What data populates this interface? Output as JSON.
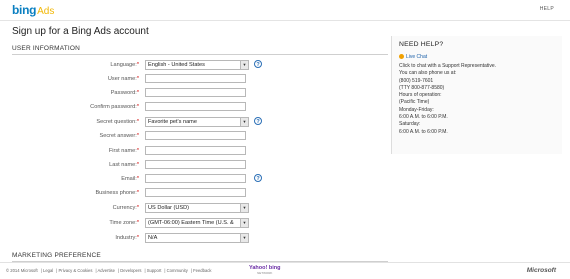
{
  "header": {
    "logo_main": "bing",
    "logo_sub": "Ads",
    "help_link": "HELP"
  },
  "page_title": "Sign up for a Bing Ads account",
  "sections": {
    "user_info": "USER INFORMATION",
    "marketing": "MARKETING PREFERENCE"
  },
  "form": {
    "language": {
      "label": "Language:",
      "value": "English - United States"
    },
    "user_name": {
      "label": "User name:"
    },
    "password": {
      "label": "Password:"
    },
    "confirm_password": {
      "label": "Confirm password:"
    },
    "secret_question": {
      "label": "Secret question:",
      "value": "Favorite pet's name"
    },
    "secret_answer": {
      "label": "Secret answer:"
    },
    "first_name": {
      "label": "First name:"
    },
    "last_name": {
      "label": "Last name:"
    },
    "email": {
      "label": "Email:"
    },
    "business_phone": {
      "label": "Business phone:"
    },
    "currency": {
      "label": "Currency:",
      "value": "US Dollar (USD)"
    },
    "time_zone": {
      "label": "Time zone:",
      "value": "(GMT-06:00) Eastern Time (U.S. &"
    },
    "industry": {
      "label": "Industry:",
      "value": "N/A"
    }
  },
  "help_box": {
    "title": "NEED HELP?",
    "live_chat": "Live Chat",
    "lines": [
      "Click to chat with a Support Representative.",
      "You can also phone us at:",
      "(800) 519-7601",
      "(TTY 800-877-8580)",
      "Hours of operation:",
      "(Pacific Time)",
      "Monday-Friday:",
      "6:00 A.M. to 6:00 P.M.",
      "Saturday:",
      "6:00 A.M. to 6:00 P.M."
    ]
  },
  "footer": {
    "links": [
      "© 2014 Microsoft",
      "Legal",
      "Privacy & Cookies",
      "Advertise",
      "Developers",
      "Support",
      "Community",
      "Feedback"
    ],
    "yb_logo": "Yahoo! bing",
    "yb_sub": "NETWORK",
    "ms_logo": "Microsoft"
  },
  "colors": {
    "brand_blue": "#0a7fc1",
    "required_red": "#d10000",
    "help_icon_blue": "#2b6fb6"
  }
}
